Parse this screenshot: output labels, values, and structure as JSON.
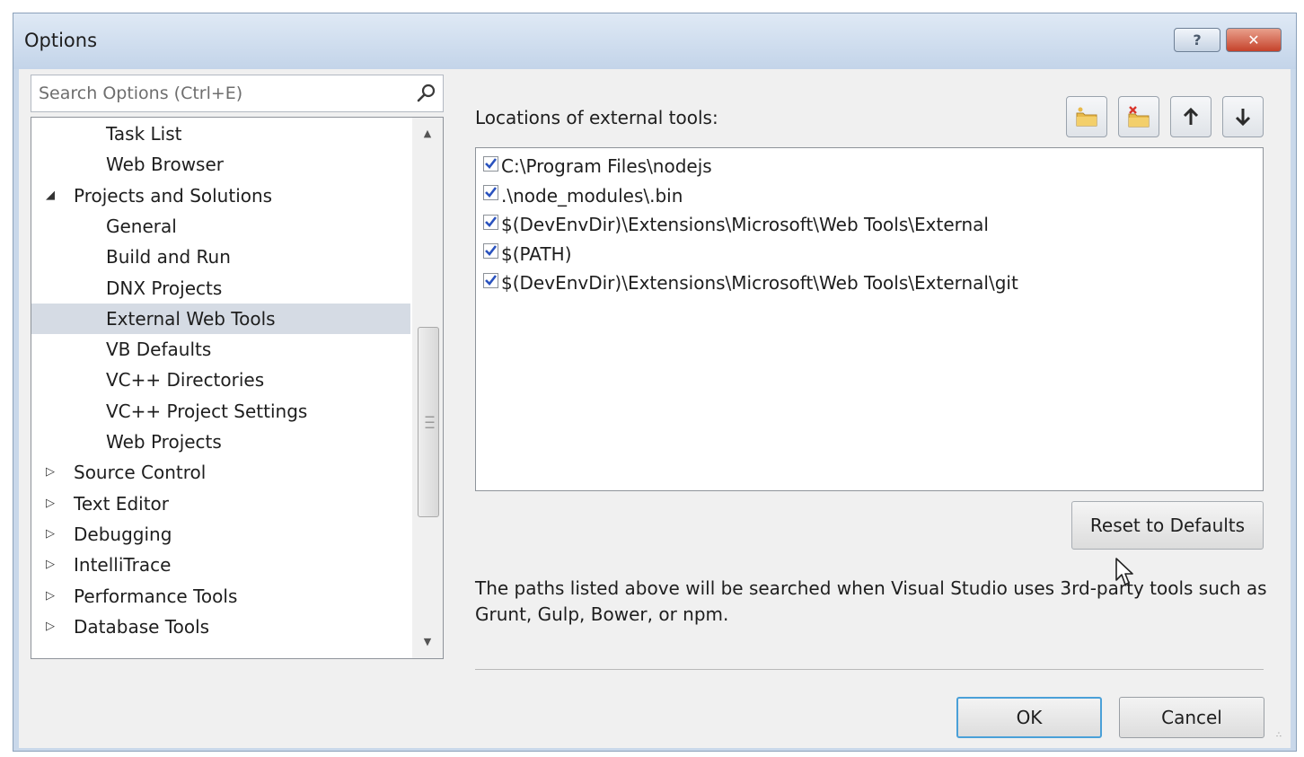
{
  "window": {
    "title": "Options",
    "help_label": "?",
    "close_label": "✕"
  },
  "search": {
    "placeholder": "Search Options (Ctrl+E)",
    "value": ""
  },
  "tree": {
    "items": [
      {
        "label": "Task List",
        "level": 2,
        "expander": ""
      },
      {
        "label": "Web Browser",
        "level": 2,
        "expander": ""
      },
      {
        "label": "Projects and Solutions",
        "level": 1,
        "expander": "expanded"
      },
      {
        "label": "General",
        "level": 2,
        "expander": ""
      },
      {
        "label": "Build and Run",
        "level": 2,
        "expander": ""
      },
      {
        "label": "DNX Projects",
        "level": 2,
        "expander": ""
      },
      {
        "label": "External Web Tools",
        "level": 2,
        "expander": "",
        "selected": true
      },
      {
        "label": "VB Defaults",
        "level": 2,
        "expander": ""
      },
      {
        "label": "VC++ Directories",
        "level": 2,
        "expander": ""
      },
      {
        "label": "VC++ Project Settings",
        "level": 2,
        "expander": ""
      },
      {
        "label": "Web Projects",
        "level": 2,
        "expander": ""
      },
      {
        "label": "Source Control",
        "level": 1,
        "expander": "collapsed"
      },
      {
        "label": "Text Editor",
        "level": 1,
        "expander": "collapsed"
      },
      {
        "label": "Debugging",
        "level": 1,
        "expander": "collapsed"
      },
      {
        "label": "IntelliTrace",
        "level": 1,
        "expander": "collapsed"
      },
      {
        "label": "Performance Tools",
        "level": 1,
        "expander": "collapsed"
      },
      {
        "label": "Database Tools",
        "level": 1,
        "expander": "collapsed"
      }
    ]
  },
  "main": {
    "locations_label": "Locations of external tools:",
    "toolbar": [
      {
        "name": "new-folder-button",
        "icon": "new-folder-icon"
      },
      {
        "name": "delete-folder-button",
        "icon": "delete-folder-icon"
      },
      {
        "name": "move-up-button",
        "icon": "arrow-up-icon"
      },
      {
        "name": "move-down-button",
        "icon": "arrow-down-icon"
      }
    ],
    "paths": [
      {
        "path": "C:\\Program Files\\nodejs",
        "checked": true
      },
      {
        "path": ".\\node_modules\\.bin",
        "checked": true
      },
      {
        "path": "$(DevEnvDir)\\Extensions\\Microsoft\\Web Tools\\External",
        "checked": true
      },
      {
        "path": "$(PATH)",
        "checked": true
      },
      {
        "path": "$(DevEnvDir)\\Extensions\\Microsoft\\Web Tools\\External\\git",
        "checked": true
      }
    ],
    "reset_label": "Reset to Defaults",
    "description": "The paths listed above will be searched when Visual Studio uses 3rd-party tools such as Grunt, Gulp, Bower, or npm."
  },
  "footer": {
    "ok_label": "OK",
    "cancel_label": "Cancel"
  },
  "colors": {
    "selection": "#d5dbe4",
    "title_bar": "#c9d8ea",
    "folder": "#e8b94a",
    "delete": "#d9342b",
    "check": "#2a52be"
  }
}
